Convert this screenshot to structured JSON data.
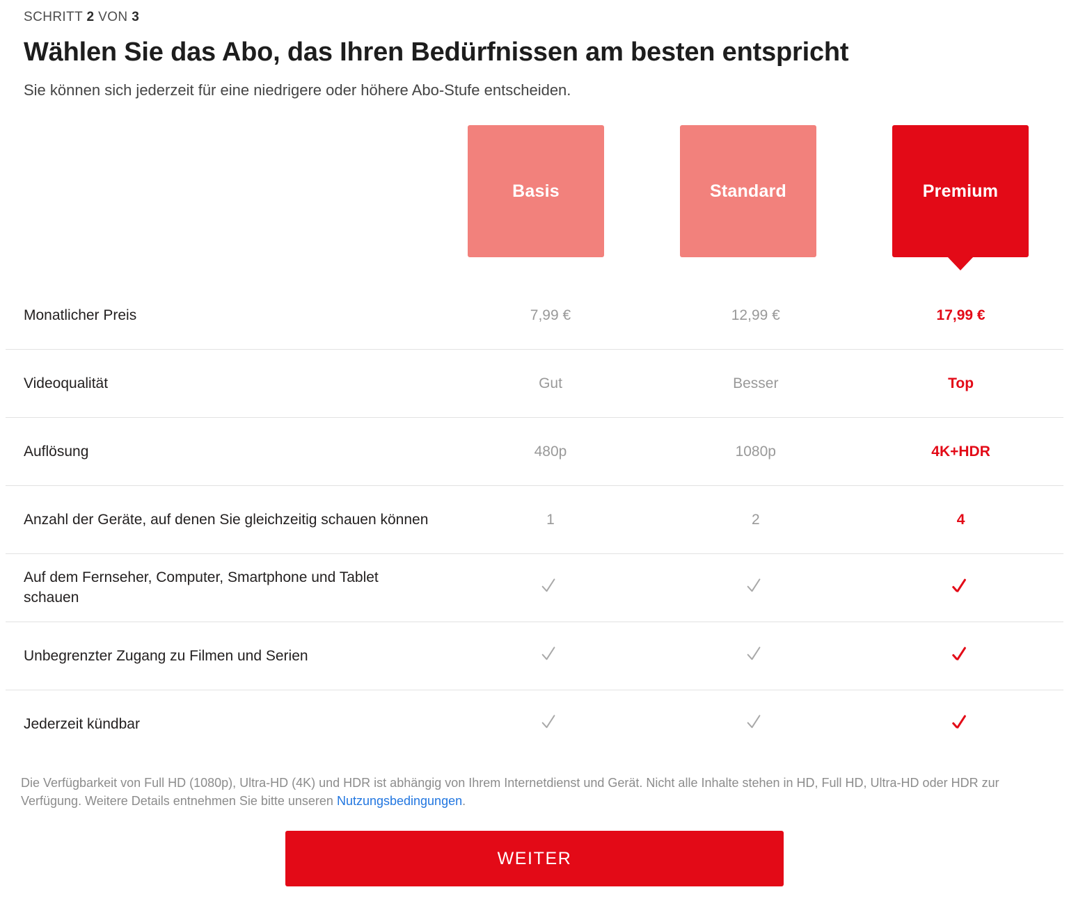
{
  "header": {
    "step_prefix": "SCHRITT",
    "step_current": "2",
    "step_middle": "VON",
    "step_total": "3",
    "title": "Wählen Sie das Abo, das Ihren Bedürfnissen am besten entspricht",
    "subtitle": "Sie können sich jederzeit für eine niedrigere oder höhere Abo-Stufe entscheiden."
  },
  "plans": [
    {
      "name": "Basis",
      "selected": false
    },
    {
      "name": "Standard",
      "selected": false
    },
    {
      "name": "Premium",
      "selected": true
    }
  ],
  "comparison": {
    "rows": [
      {
        "label": "Monatlicher Preis",
        "values": [
          "7,99 €",
          "12,99 €",
          "17,99 €"
        ],
        "type": "text"
      },
      {
        "label": "Videoqualität",
        "values": [
          "Gut",
          "Besser",
          "Top"
        ],
        "type": "text"
      },
      {
        "label": "Auflösung",
        "values": [
          "480p",
          "1080p",
          "4K+HDR"
        ],
        "type": "text"
      },
      {
        "label": "Anzahl der Geräte, auf denen Sie gleichzeitig schauen können",
        "values": [
          "1",
          "2",
          "4"
        ],
        "type": "text"
      },
      {
        "label": "Auf dem Fernseher, Computer, Smartphone und Tablet schauen",
        "values": [
          "check-icon",
          "check-icon",
          "check-icon"
        ],
        "type": "check"
      },
      {
        "label": "Unbegrenzter Zugang zu Filmen und Serien",
        "values": [
          "check-icon",
          "check-icon",
          "check-icon"
        ],
        "type": "check"
      },
      {
        "label": "Jederzeit kündbar",
        "values": [
          "check-icon",
          "check-icon",
          "check-icon"
        ],
        "type": "check"
      }
    ]
  },
  "footnote": {
    "text_before_link": "Die Verfügbarkeit von Full HD (1080p), Ultra-HD (4K) und HDR ist abhängig von Ihrem Internetdienst und Gerät. Nicht alle Inhalte stehen in HD, Full HD, Ultra-HD oder HDR zur Verfügung. Weitere Details entnehmen Sie bitte unseren ",
    "link_text": "Nutzungsbedingungen",
    "text_after_link": "."
  },
  "cta": {
    "label": "WEITER"
  },
  "colors": {
    "brand_red": "#e30a17",
    "plan_dim": "#f2817c",
    "link_blue": "#2176e0",
    "muted_text": "#999999",
    "divider": "#e2e2e2"
  }
}
